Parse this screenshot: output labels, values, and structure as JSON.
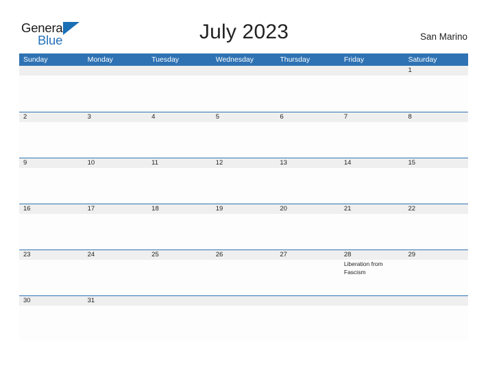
{
  "brand": {
    "name_part1": "General",
    "name_part2": "Blue",
    "color_black": "#1a1a1a",
    "color_blue": "#2472b8"
  },
  "header": {
    "title": "July 2023",
    "region": "San Marino"
  },
  "theme": {
    "header_blue": "#2e72b3",
    "number_band_gray": "#efefef",
    "text_dark": "#222222"
  },
  "calendar": {
    "weekday_headers": [
      "Sunday",
      "Monday",
      "Tuesday",
      "Wednesday",
      "Thursday",
      "Friday",
      "Saturday"
    ],
    "weeks": [
      {
        "days": [
          {
            "number": "",
            "event": ""
          },
          {
            "number": "",
            "event": ""
          },
          {
            "number": "",
            "event": ""
          },
          {
            "number": "",
            "event": ""
          },
          {
            "number": "",
            "event": ""
          },
          {
            "number": "",
            "event": ""
          },
          {
            "number": "1",
            "event": ""
          }
        ]
      },
      {
        "days": [
          {
            "number": "2",
            "event": ""
          },
          {
            "number": "3",
            "event": ""
          },
          {
            "number": "4",
            "event": ""
          },
          {
            "number": "5",
            "event": ""
          },
          {
            "number": "6",
            "event": ""
          },
          {
            "number": "7",
            "event": ""
          },
          {
            "number": "8",
            "event": ""
          }
        ]
      },
      {
        "days": [
          {
            "number": "9",
            "event": ""
          },
          {
            "number": "10",
            "event": ""
          },
          {
            "number": "11",
            "event": ""
          },
          {
            "number": "12",
            "event": ""
          },
          {
            "number": "13",
            "event": ""
          },
          {
            "number": "14",
            "event": ""
          },
          {
            "number": "15",
            "event": ""
          }
        ]
      },
      {
        "days": [
          {
            "number": "16",
            "event": ""
          },
          {
            "number": "17",
            "event": ""
          },
          {
            "number": "18",
            "event": ""
          },
          {
            "number": "19",
            "event": ""
          },
          {
            "number": "20",
            "event": ""
          },
          {
            "number": "21",
            "event": ""
          },
          {
            "number": "22",
            "event": ""
          }
        ]
      },
      {
        "days": [
          {
            "number": "23",
            "event": ""
          },
          {
            "number": "24",
            "event": ""
          },
          {
            "number": "25",
            "event": ""
          },
          {
            "number": "26",
            "event": ""
          },
          {
            "number": "27",
            "event": ""
          },
          {
            "number": "28",
            "event": "Liberation from Fascism"
          },
          {
            "number": "29",
            "event": ""
          }
        ]
      },
      {
        "days": [
          {
            "number": "30",
            "event": ""
          },
          {
            "number": "31",
            "event": ""
          },
          {
            "number": "",
            "event": ""
          },
          {
            "number": "",
            "event": ""
          },
          {
            "number": "",
            "event": ""
          },
          {
            "number": "",
            "event": ""
          },
          {
            "number": "",
            "event": ""
          }
        ]
      }
    ]
  }
}
